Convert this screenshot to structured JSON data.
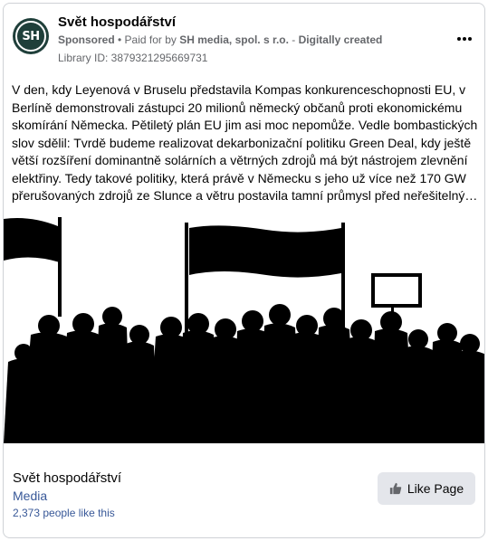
{
  "header": {
    "avatar_text": "SH",
    "page_name": "Svět hospodářství",
    "sponsored": "Sponsored",
    "separator": " • ",
    "paid_for": "Paid for by ",
    "payer": "SH media, spol. s r.o.",
    "dash": " - ",
    "digitally_created": "Digitally created",
    "library_id": "Library ID: 3879321295669731",
    "more_icon": "more-horizontal-icon"
  },
  "body": {
    "text": "V den, kdy Leyenová v Bruselu představila Kompas konkurenceschopnosti EU, v Berlíně demonstrovali zástupci 20 milionů německý občanů proti ekonomickému skomírání Německa. Pětiletý plán EU jim asi moc nepomůže. Vedle bombastických slov sdělil: Tvrdě budeme realizovat dekarbonizační politiku Green Deal, kdy ještě větší rozšíření dominantně solárních a větrných zdrojů má být nástrojem zlevnění elektřiny. Tedy takové politiky, která právě v Německu s jeho už více než 170 GW přerušovaných zdrojů ze Slunce a větru postavila tamní průmysl před neřešitelný…"
  },
  "footer": {
    "page_name": "Svět hospodářství",
    "category": "Media",
    "likes": "2,373 people like this",
    "like_button": "Like Page",
    "like_icon": "thumbs-up-icon"
  },
  "colors": {
    "avatar_bg": "#1f3f3a",
    "link": "#385898",
    "muted": "#65676b",
    "button_bg": "#e4e6eb"
  }
}
